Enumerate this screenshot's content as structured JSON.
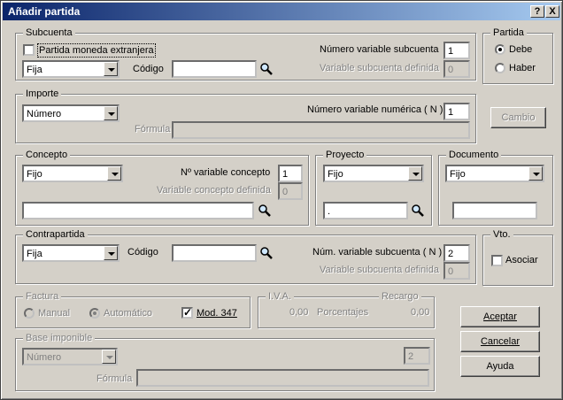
{
  "window": {
    "title": "Añadir partida",
    "help_btn": "?",
    "close_btn": "X"
  },
  "subcuenta": {
    "legend": "Subcuenta",
    "moneda_label": "Partida moneda extranjera",
    "tipo": "Fija",
    "codigo_label": "Código",
    "codigo_value": "",
    "numvar_label": "Número variable subcuenta",
    "numvar_value": "1",
    "vardef_label": "Variable subcuenta definida",
    "vardef_value": "0"
  },
  "partida": {
    "legend": "Partida",
    "debe": "Debe",
    "haber": "Haber",
    "selected": "Debe"
  },
  "importe": {
    "legend": "Importe",
    "tipo": "Número",
    "numvar_label": "Número variable numérica ( N )",
    "numvar_value": "1",
    "formula_label": "Fórmula",
    "formula_value": ""
  },
  "cambio_button": "Cambio",
  "concepto": {
    "legend": "Concepto",
    "tipo": "Fijo",
    "numvar_label": "Nº variable concepto",
    "numvar_value": "1",
    "vardef_label": "Variable concepto definida",
    "vardef_value": "0",
    "text_value": ""
  },
  "proyecto": {
    "legend": "Proyecto",
    "tipo": "Fijo",
    "value": "."
  },
  "documento": {
    "legend": "Documento",
    "tipo": "Fijo",
    "value": ""
  },
  "contrapartida": {
    "legend": "Contrapartida",
    "tipo": "Fija",
    "codigo_label": "Código",
    "codigo_value": "",
    "numvar_label": "Núm. variable subcuenta ( N )",
    "numvar_value": "2",
    "vardef_label": "Variable subcuenta definida",
    "vardef_value": "0"
  },
  "vto": {
    "legend": "Vto.",
    "asociar_label": "Asociar"
  },
  "factura": {
    "legend": "Factura",
    "manual": "Manual",
    "automatico": "Automático",
    "mod347": "Mod. 347"
  },
  "iva": {
    "legend": "I.V.A.",
    "value": "0,00",
    "porcentajes": "Porcentajes"
  },
  "recargo": {
    "legend": "Recargo",
    "value": "0,00"
  },
  "base": {
    "legend": "Base imponible",
    "tipo": "Número",
    "numvar_value": "2",
    "formula_label": "Fórmula",
    "formula_value": ""
  },
  "buttons": {
    "aceptar": "Aceptar",
    "cancelar": "Cancelar",
    "ayuda": "Ayuda"
  }
}
